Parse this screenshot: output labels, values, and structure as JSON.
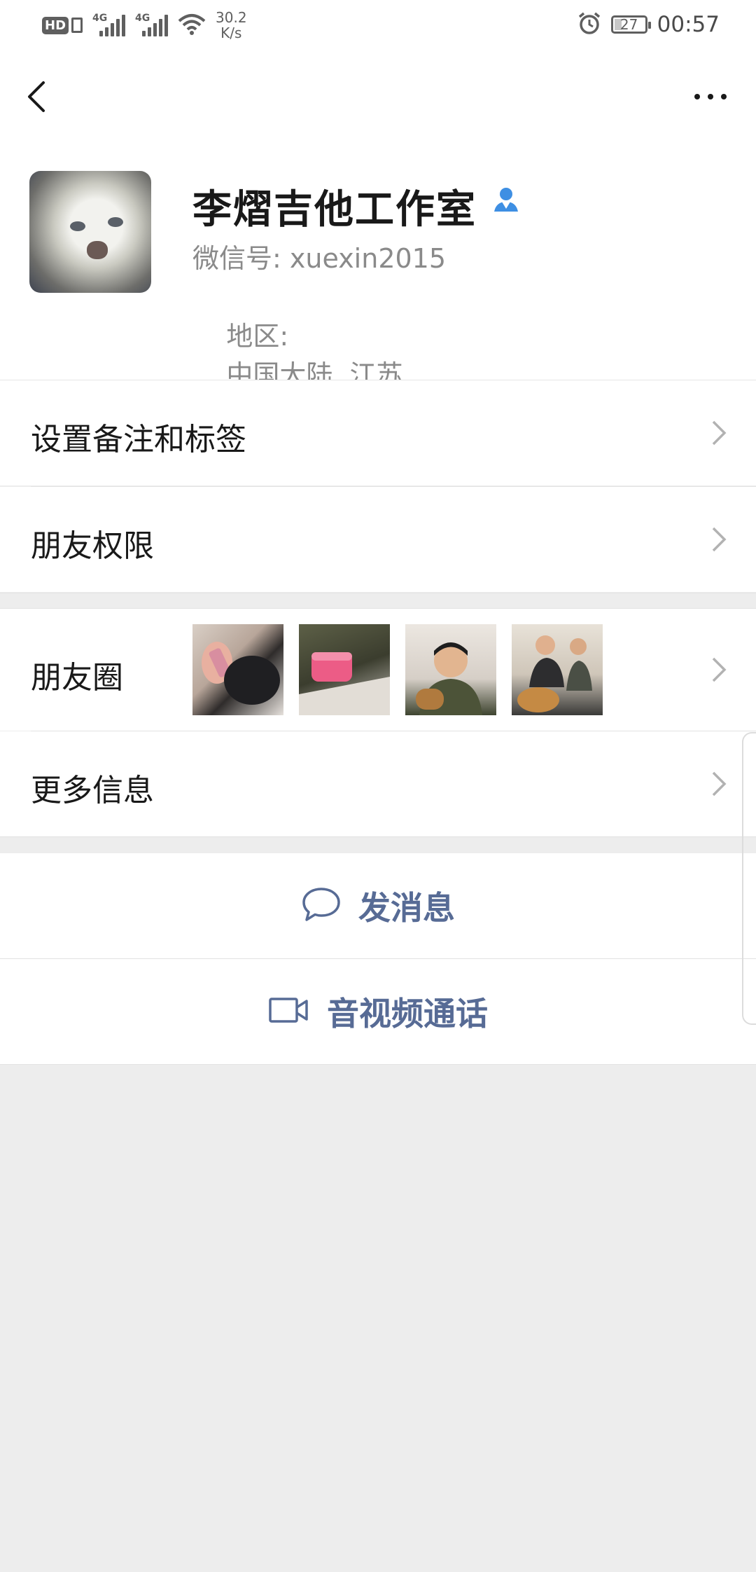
{
  "status_bar": {
    "hd_label": "HD",
    "network_1": "4G",
    "network_2": "4G",
    "speed_value": "30.2",
    "speed_unit": "K/s",
    "battery": "27",
    "time": "00:57"
  },
  "nav": {
    "back_icon": "chevron-left-icon",
    "more_icon": "ellipsis-icon"
  },
  "profile": {
    "name": "李熠吉他工作室",
    "wechat_id_label": "微信号:",
    "wechat_id": "xuexin2015",
    "region_label": "地区:",
    "region": "中国大陆  江苏"
  },
  "rows": {
    "remark_tags": "设置备注和标签",
    "friend_permissions": "朋友权限",
    "moments": "朋友圈",
    "more_info": "更多信息"
  },
  "actions": {
    "send_message": "发消息",
    "video_call": "音视频通话"
  },
  "colors": {
    "link_blue": "#576b95",
    "background_gray": "#ededed",
    "verified_blue": "#3e8fe3"
  }
}
